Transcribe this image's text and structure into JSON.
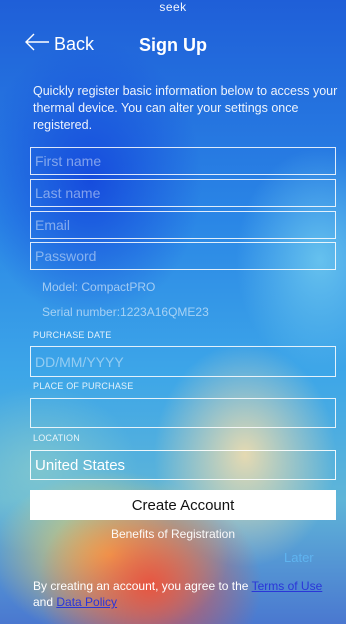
{
  "header": {
    "logo_text": "seek",
    "back_label": "Back",
    "title": "Sign Up"
  },
  "intro_text": "Quickly register basic information below to access your thermal device. You can alter your settings once registered.",
  "form": {
    "first_name_placeholder": "First name",
    "last_name_placeholder": "Last name",
    "email_placeholder": "Email",
    "password_placeholder": "Password",
    "model_text": "Model: CompactPRO",
    "serial_text": "Serial number:1223A16QME23",
    "purchase_date_label": "PURCHASE DATE",
    "purchase_date_placeholder": "DD/MM/YYYY",
    "place_of_purchase_label": "PLACE OF PURCHASE",
    "place_of_purchase_value": "",
    "location_label": "LOCATION",
    "location_value": "United States"
  },
  "actions": {
    "create_account_label": "Create Account",
    "benefits_label": "Benefits of Registration",
    "later_label": "Later"
  },
  "footer": {
    "terms_prefix": "By creating an account, you agree to the ",
    "terms_link": "Terms of Use",
    "and_text": " and ",
    "data_policy_link": "Data Policy"
  },
  "colors": {
    "link_blue": "#2a36d8",
    "later_blue": "#5fb4f0"
  }
}
